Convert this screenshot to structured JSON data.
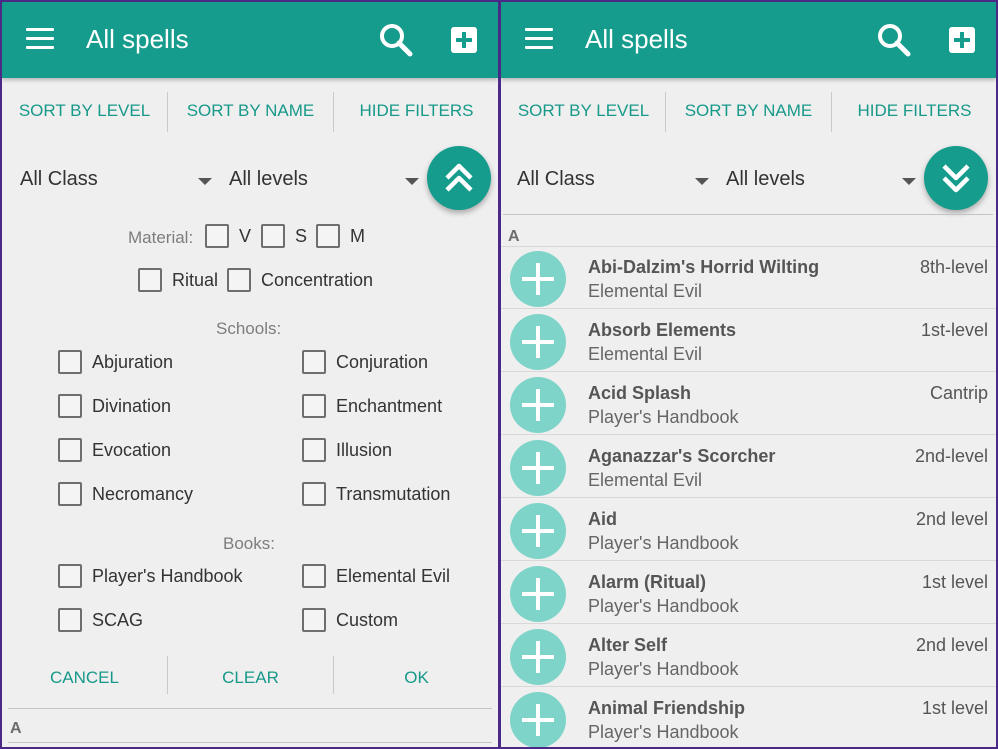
{
  "app": {
    "title": "All spells",
    "accent_color": "#159c8c",
    "icons": {
      "menu": "hamburger-menu-icon",
      "search": "search-icon",
      "add": "add-box-icon"
    }
  },
  "sortbar": {
    "sort_by_level": "SORT BY LEVEL",
    "sort_by_name": "SORT BY NAME",
    "hide_filters": "HIDE FILTERS"
  },
  "filters": {
    "class_selected": "All Class",
    "level_selected": "All levels",
    "material_label": "Material:",
    "components": [
      "V",
      "S",
      "M"
    ],
    "ritual": "Ritual",
    "concentration": "Concentration",
    "schools_label": "Schools:",
    "schools": [
      "Abjuration",
      "Conjuration",
      "Divination",
      "Enchantment",
      "Evocation",
      "Illusion",
      "Necromancy",
      "Transmutation"
    ],
    "books_label": "Books:",
    "books": [
      "Player's Handbook",
      "Elemental Evil",
      "SCAG",
      "Custom"
    ],
    "cancel": "CANCEL",
    "clear": "CLEAR",
    "ok": "OK"
  },
  "list": {
    "section_letter": "A",
    "spells": [
      {
        "name": "Abi-Dalzim's Horrid Wilting",
        "book": "Elemental Evil",
        "level": "8th-level"
      },
      {
        "name": "Absorb Elements",
        "book": "Elemental Evil",
        "level": "1st-level"
      },
      {
        "name": "Acid Splash",
        "book": "Player's Handbook",
        "level": "Cantrip"
      },
      {
        "name": "Aganazzar's Scorcher",
        "book": "Elemental Evil",
        "level": "2nd-level"
      },
      {
        "name": "Aid",
        "book": "Player's Handbook",
        "level": "2nd level"
      },
      {
        "name": "Alarm (Ritual)",
        "book": "Player's Handbook",
        "level": "1st level"
      },
      {
        "name": "Alter Self",
        "book": "Player's Handbook",
        "level": "2nd level"
      },
      {
        "name": "Animal Friendship",
        "book": "Player's Handbook",
        "level": "1st level"
      }
    ]
  }
}
